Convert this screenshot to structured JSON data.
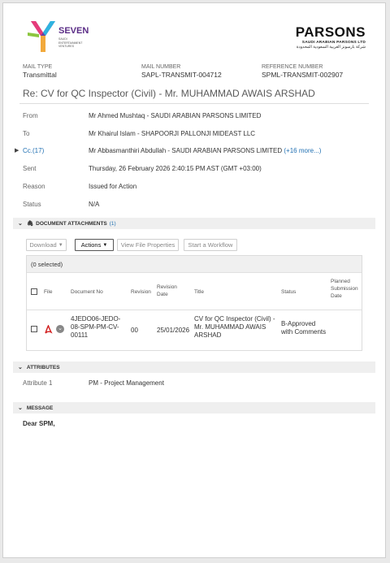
{
  "logo_left": {
    "name": "SEVEN",
    "sub1": "SAUDI",
    "sub2": "ENTERTAINMENT",
    "sub3": "VENTURES"
  },
  "logo_right": {
    "name": "PARSONS",
    "sub": "SAUDI ARABIAN PARSONS LTD",
    "arabic": "شركة بارسونز العربية السعودية المحدودة"
  },
  "meta": [
    {
      "label": "MAIL TYPE",
      "value": "Transmittal"
    },
    {
      "label": "MAIL NUMBER",
      "value": "SAPL-TRANSMIT-004712"
    },
    {
      "label": "REFERENCE NUMBER",
      "value": "SPML-TRANSMIT-002907"
    }
  ],
  "subject": "Re: CV for QC Inspector (Civil) - Mr. MUHAMMAD AWAIS ARSHAD",
  "fields": {
    "from": {
      "label": "From",
      "value": "Mr Ahmed Mushtaq - SAUDI ARABIAN PARSONS LIMITED"
    },
    "to": {
      "label": "To",
      "value": "Mr Khairul Islam - SHAPOORJI PALLONJI MIDEAST LLC"
    },
    "cc": {
      "label": "Cc.(17)",
      "value": "Mr Abbasmanthiri Abdullah - SAUDI ARABIAN PARSONS LIMITED",
      "more": "(+16 more...)"
    },
    "sent": {
      "label": "Sent",
      "value": "Thursday, 26 February 2026 2:40:15 PM AST (GMT +03:00)"
    },
    "reason": {
      "label": "Reason",
      "value": "Issued for Action"
    },
    "status": {
      "label": "Status",
      "value": "N/A"
    }
  },
  "attachments": {
    "title": "DOCUMENT ATTACHMENTS",
    "count": "(1)",
    "buttons": {
      "download": "Download",
      "actions": "Actions",
      "view": "View File Properties",
      "workflow": "Start a Workflow"
    },
    "selected": "(0 selected)",
    "headers": {
      "file": "File",
      "docno": "Document No",
      "revision": "Revision",
      "revdate": "Revision Date",
      "title": "Title",
      "status": "Status",
      "planned": "Planned Submission Date"
    },
    "rows": [
      {
        "docno": "4JEDO06-JEDO-08-SPM-PM-CV-00111",
        "revision": "00",
        "revdate": "25/01/2026",
        "title": "CV for QC Inspector (Civil) - Mr. MUHAMMAD AWAIS ARSHAD",
        "status": "B-Approved with Comments",
        "planned": ""
      }
    ]
  },
  "attributes": {
    "title": "ATTRIBUTES",
    "label": "Attribute 1",
    "value": "PM - Project Management"
  },
  "message": {
    "title": "MESSAGE",
    "body": "Dear SPM,"
  }
}
